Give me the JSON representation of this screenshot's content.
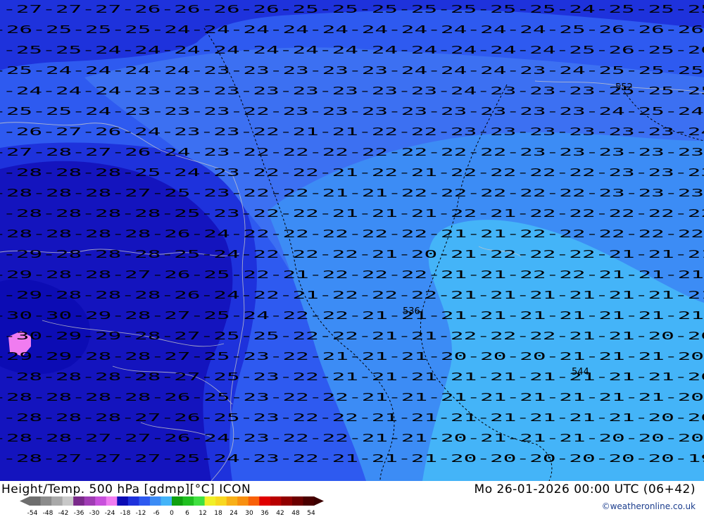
{
  "footer": {
    "title_left": "Height/Temp. 500 hPa [gdmp][°C] ICON",
    "title_right": "Mo 26-01-2026 00:00 UTC (06+42)",
    "credit": "©weatheronline.co.uk"
  },
  "colorbar": {
    "ticks": [
      "-54",
      "-48",
      "-42",
      "-36",
      "-30",
      "-24",
      "-18",
      "-12",
      "-6",
      "0",
      "6",
      "12",
      "18",
      "24",
      "30",
      "36",
      "42",
      "48",
      "54"
    ],
    "colors": [
      "#6e6e6e",
      "#8c8c8c",
      "#a9a9a9",
      "#c8c8c8",
      "#7a2a8a",
      "#a03cb4",
      "#c850dc",
      "#f07cf0",
      "#0c0cb4",
      "#1e32dc",
      "#2e5af0",
      "#3c8cf5",
      "#44b4f8",
      "#10a010",
      "#20c020",
      "#40e040",
      "#f0f028",
      "#f8d820",
      "#f8b018",
      "#f89010",
      "#f86008",
      "#e00000",
      "#b80000",
      "#900000",
      "#6c0000",
      "#4a0000"
    ],
    "arrow_left_color": "#6e6e6e",
    "arrow_right_color": "#3c0000"
  },
  "map": {
    "contour_labels": [
      {
        "text": "536",
        "kind": "height"
      },
      {
        "text": "544",
        "kind": "height"
      },
      {
        "text": "552",
        "kind": "height"
      }
    ],
    "temperature_rows": [
      "-27-27-27-26-26-26-26-25-25-25-25-25-25-25-24-25-25-25",
      "-26-25-25-25-24-24-24-24-24-24-24-24-24-24-25-26-26-26",
      "-25-25-24-24-24-24-24-24-24-24-24-24-24-24-25-26-25-26",
      "-25-24-24-24-24-23-23-23-23-23-24-24-24-23-24-25-25-25",
      "-24-24-24-23-23-23-23-23-23-23-23-24-23-23-23-25-25-25",
      "-25-25-24-23-23-23-22-23-23-23-23-23-23-23-23-24-25-24",
      "-26-27-26-24-23-23-22-21-21-22-22-23-23-23-23-23-23-24",
      "-27-28-27-26-24-23-22-22-22-22-22-22-22-23-23-23-23-23",
      "-28-28-28-25-24-23-22-22-21-22-21-22-22-22-22-23-23-23",
      "-28-28-28-27-25-23-22-22-21-21-22-22-22-22-22-23-23-23",
      "-28-28-28-28-25-23-22-22-21-21-21-22-21-22-22-22-22-22",
      "-28-28-28-28-26-24-22-22-22-22-22-21-21-22-22-22-22-22",
      "-29-28-28-28-25-24-22-22-22-21-20-21-22-22-22-21-21-21",
      "-29-28-28-27-26-25-22-21-22-22-22-21-21-22-22-21-21-21",
      "-29-28-28-28-26-24-22-21-22-22-22-21-21-21-21-21-21-21",
      "-30-30-29-28-27-25-24-22-22-21-21-21-21-21-21-21-21-21",
      "-30-29-29-28-27-25-25-22-22-21-21-22-22-22-21-21-20-20",
      "-29-29-28-28-27-25-23-22-21-21-21-20-20-20-21-21-21-20",
      "-28-28-28-28-27-25-23-22-21-21-21-21-21-21-21-21-21-20",
      "-28-28-28-28-26-25-23-22-22-21-21-21-21-21-21-21-21-20",
      "-28-28-28-27-26-25-23-22-22-21-21-21-21-21-21-21-20-20",
      "-28-28-27-27-26-24-23-22-22-21-21-20-21-21-21-20-20-20",
      "-28-27-27-27-25-24-23-22-21-21-21-20-20-20-20-20-20-19"
    ]
  }
}
